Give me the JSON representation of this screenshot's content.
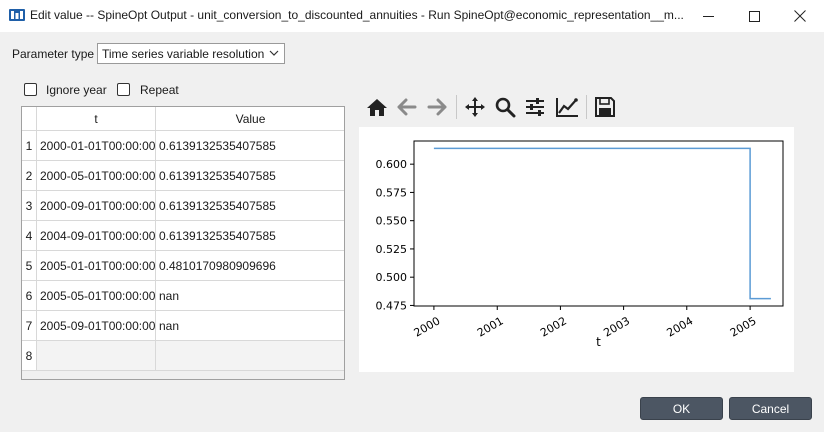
{
  "window": {
    "title": "Edit value   -- SpineOpt Output - unit_conversion_to_discounted_annuities - Run SpineOpt@economic_representation__m...",
    "icons": [
      "app-icon",
      "minimize-icon",
      "maximize-icon",
      "close-icon"
    ]
  },
  "parameter_type": {
    "label": "Parameter type",
    "selected": "Time series variable resolution"
  },
  "options": {
    "ignore_year": "Ignore year",
    "repeat": "Repeat"
  },
  "table": {
    "columns": [
      "t",
      "Value"
    ],
    "rows": [
      {
        "n": "1",
        "t": "2000-01-01T00:00:00",
        "value": "0.6139132535407585"
      },
      {
        "n": "2",
        "t": "2000-05-01T00:00:00",
        "value": "0.6139132535407585"
      },
      {
        "n": "3",
        "t": "2000-09-01T00:00:00",
        "value": "0.6139132535407585"
      },
      {
        "n": "4",
        "t": "2004-09-01T00:00:00",
        "value": "0.6139132535407585"
      },
      {
        "n": "5",
        "t": "2005-01-01T00:00:00",
        "value": "0.4810170980909696"
      },
      {
        "n": "6",
        "t": "2005-05-01T00:00:00",
        "value": "nan"
      },
      {
        "n": "7",
        "t": "2005-09-01T00:00:00",
        "value": "nan"
      },
      {
        "n": "8",
        "t": "",
        "value": ""
      }
    ]
  },
  "toolbar": {
    "icons": [
      "home-icon",
      "back-arrow-icon",
      "forward-arrow-icon",
      "pan-icon",
      "zoom-icon",
      "configure-subplots-icon",
      "edit-curve-icon",
      "save-icon"
    ]
  },
  "chart_data": {
    "type": "line",
    "step": "post",
    "x": [
      "2000-01-01",
      "2000-05-01",
      "2000-09-01",
      "2004-09-01",
      "2005-01-01",
      "2005-05-01",
      "2005-09-01"
    ],
    "y": [
      0.6139132535407585,
      0.6139132535407585,
      0.6139132535407585,
      0.6139132535407585,
      0.4810170980909696,
      null,
      null
    ],
    "xlabel": "t",
    "ylabel": "",
    "x_ticks": [
      "2000",
      "2001",
      "2002",
      "2003",
      "2004",
      "2005"
    ],
    "y_ticks": [
      "0.475",
      "0.500",
      "0.525",
      "0.550",
      "0.575",
      "0.600"
    ],
    "ylim": [
      0.4745,
      0.6205
    ],
    "xlim": [
      "1999-09-08",
      "2005-07-10"
    ],
    "line_color": "#5b9bd5"
  },
  "buttons": {
    "ok": "OK",
    "cancel": "Cancel"
  }
}
